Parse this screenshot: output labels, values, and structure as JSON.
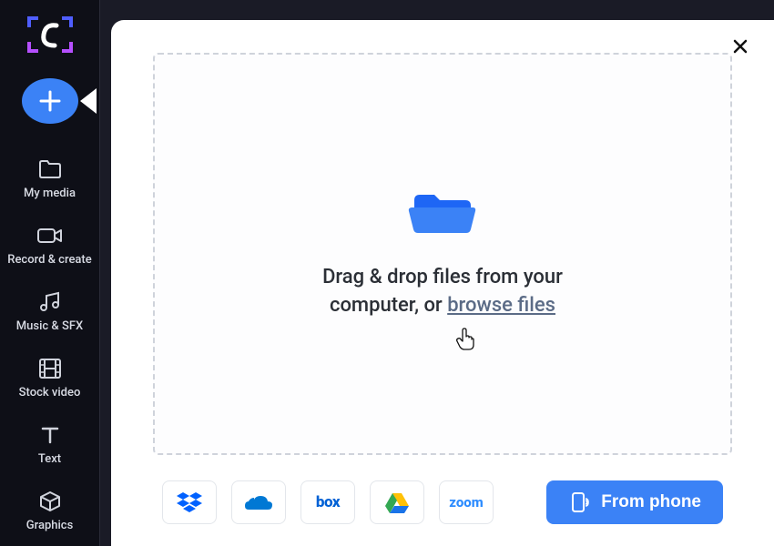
{
  "sidebar": {
    "items": [
      {
        "label": "My media"
      },
      {
        "label": "Record & create"
      },
      {
        "label": "Music & SFX"
      },
      {
        "label": "Stock video"
      },
      {
        "label": "Text"
      },
      {
        "label": "Graphics"
      }
    ]
  },
  "modal": {
    "drop_text_prefix": "Drag & drop files from your computer, or ",
    "browse_link": "browse files",
    "phone_button": "From phone",
    "sources": [
      {
        "name": "dropbox"
      },
      {
        "name": "onedrive"
      },
      {
        "name": "box"
      },
      {
        "name": "googledrive"
      },
      {
        "name": "zoom"
      }
    ]
  },
  "colors": {
    "accent": "#3b82f6"
  }
}
